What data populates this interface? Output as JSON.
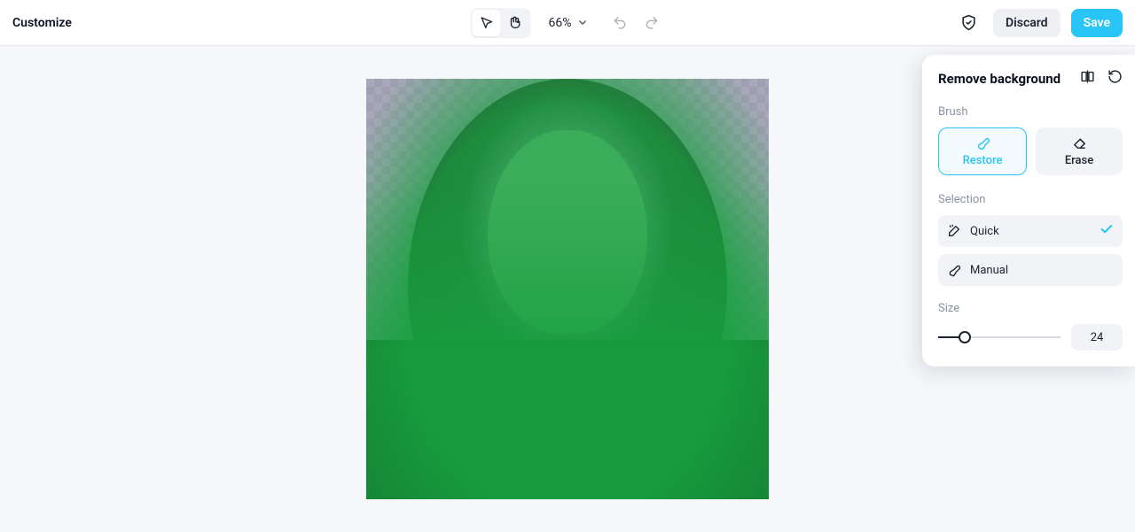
{
  "toolbar": {
    "title": "Customize",
    "zoom": "66%",
    "discard_label": "Discard",
    "save_label": "Save"
  },
  "panel": {
    "title": "Remove background",
    "brush_label": "Brush",
    "restore_label": "Restore",
    "erase_label": "Erase",
    "selection_label": "Selection",
    "quick_label": "Quick",
    "manual_label": "Manual",
    "size_label": "Size",
    "size_value": "24"
  }
}
